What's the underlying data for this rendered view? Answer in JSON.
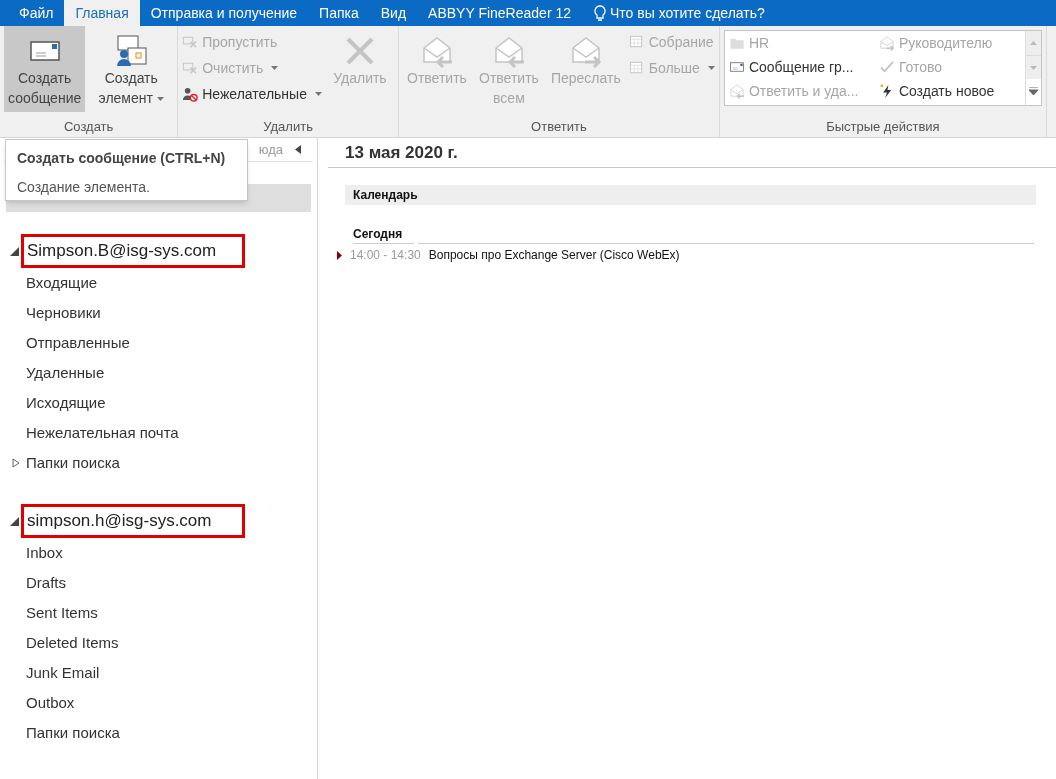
{
  "tabs": [
    {
      "label": "Файл",
      "selected": false
    },
    {
      "label": "Главная",
      "selected": true
    },
    {
      "label": "Отправка и получение",
      "selected": false
    },
    {
      "label": "Папка",
      "selected": false
    },
    {
      "label": "Вид",
      "selected": false
    },
    {
      "label": "ABBYY FineReader 12",
      "selected": false
    }
  ],
  "tell_me": "Что вы хотите сделать?",
  "ribbon": {
    "groups": [
      {
        "label": "Создать",
        "items": [
          {
            "kind": "large",
            "label": "Создать сообщение",
            "disabled": false,
            "pressed": true,
            "dropdown": false
          },
          {
            "kind": "large",
            "label": "Создать элемент",
            "disabled": false,
            "pressed": false,
            "dropdown": true
          }
        ]
      },
      {
        "label": "Удалить",
        "items": [
          {
            "kind": "stack",
            "children": [
              {
                "label": "Пропустить",
                "disabled": true,
                "dropdown": false
              },
              {
                "label": "Очистить",
                "disabled": true,
                "dropdown": true
              },
              {
                "label": "Нежелательные",
                "disabled": false,
                "dropdown": true
              }
            ]
          },
          {
            "kind": "large",
            "label": "Удалить",
            "disabled": true,
            "pressed": false,
            "dropdown": false
          }
        ]
      },
      {
        "label": "Ответить",
        "items": [
          {
            "kind": "large",
            "label": "Ответить",
            "disabled": true,
            "pressed": false,
            "dropdown": false
          },
          {
            "kind": "large",
            "label": "Ответить всем",
            "disabled": true,
            "pressed": false,
            "dropdown": false
          },
          {
            "kind": "large",
            "label": "Переслать",
            "disabled": true,
            "pressed": false,
            "dropdown": false
          },
          {
            "kind": "stack",
            "children": [
              {
                "label": "Собрание",
                "disabled": true,
                "dropdown": false
              },
              {
                "label": "Больше",
                "disabled": true,
                "dropdown": true
              }
            ]
          }
        ]
      },
      {
        "label": "Быстрые действия",
        "items": [
          {
            "kind": "quick",
            "columns": [
              [
                {
                  "label": "HR",
                  "disabled": true
                },
                {
                  "label": "Сообщение гр...",
                  "disabled": false
                },
                {
                  "label": "Ответить и уда...",
                  "disabled": true
                }
              ],
              [
                {
                  "label": "Руководителю",
                  "disabled": true
                },
                {
                  "label": "Готово",
                  "disabled": true
                },
                {
                  "label": "Создать новое",
                  "disabled": false
                }
              ]
            ]
          }
        ]
      }
    ]
  },
  "tooltip": {
    "title": "Создать сообщение (CTRL+N)",
    "text": "Создание элемента."
  },
  "sidebar": {
    "header_fragment": "юда",
    "accounts": [
      {
        "name": "Simpson.B@isg-sys.com",
        "expanded": true,
        "highlighted": true,
        "folders": [
          {
            "label": "Входящие",
            "kind": "plain"
          },
          {
            "label": "Черновики",
            "kind": "plain"
          },
          {
            "label": "Отправленные",
            "kind": "plain"
          },
          {
            "label": "Удаленные",
            "kind": "plain"
          },
          {
            "label": "Исходящие",
            "kind": "plain"
          },
          {
            "label": "Нежелательная почта",
            "kind": "plain"
          },
          {
            "label": "Папки поиска",
            "kind": "collapsed"
          }
        ]
      },
      {
        "name": "simpson.h@isg-sys.com",
        "expanded": true,
        "highlighted": true,
        "folders": [
          {
            "label": "Inbox",
            "kind": "plain"
          },
          {
            "label": "Drafts",
            "kind": "plain"
          },
          {
            "label": "Sent Items",
            "kind": "plain"
          },
          {
            "label": "Deleted Items",
            "kind": "plain"
          },
          {
            "label": "Junk Email",
            "kind": "plain"
          },
          {
            "label": "Outbox",
            "kind": "plain"
          },
          {
            "label": "Папки поиска",
            "kind": "plain"
          }
        ]
      }
    ]
  },
  "main": {
    "date": "13 мая 2020 г.",
    "section": "Календарь",
    "day": "Сегодня",
    "events": [
      {
        "time": "14:00 - 14:30",
        "title": "Вопросы про Exchange Server (Cisco WebEx)"
      }
    ]
  }
}
